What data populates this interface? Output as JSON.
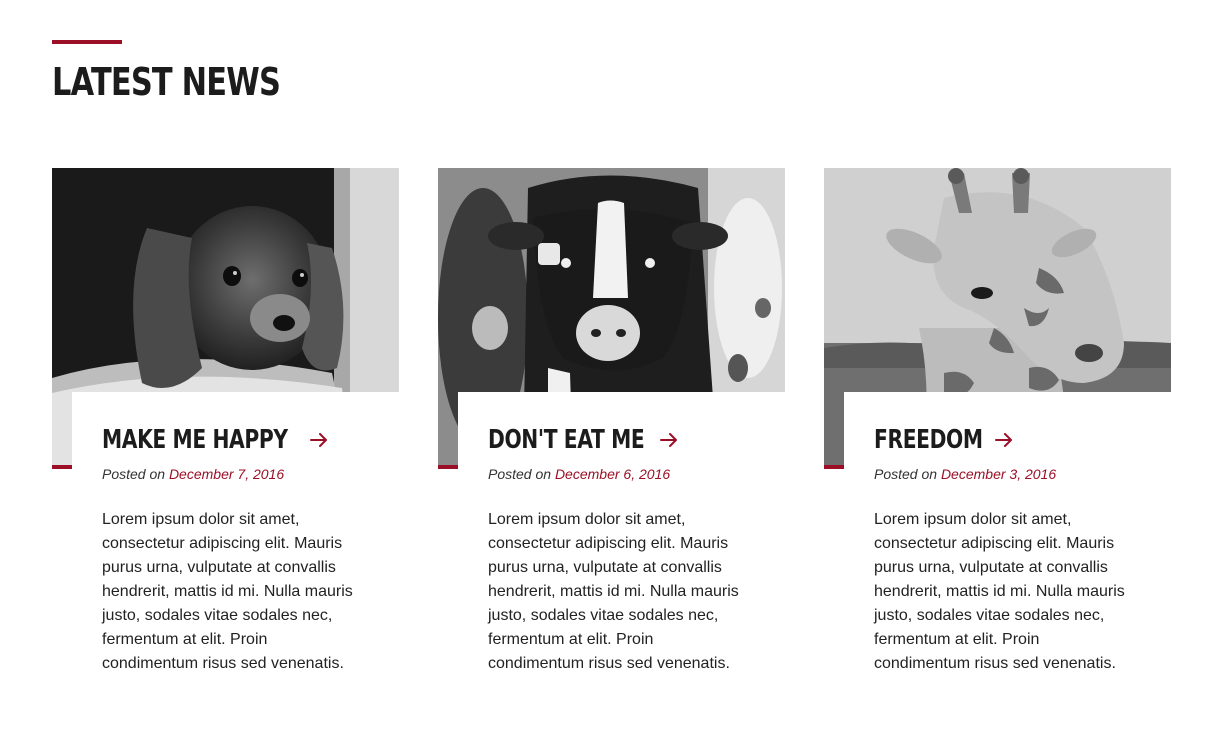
{
  "section": {
    "title": "LATEST NEWS"
  },
  "colors": {
    "accent": "#9b1026",
    "heading": "#1c1c1c",
    "body_text": "#222222"
  },
  "posts": [
    {
      "title": "MAKE ME HAPPY",
      "posted_on": "Posted on",
      "date": "December 7, 2016",
      "excerpt": "Lorem ipsum dolor sit amet, consectetur adipiscing elit. Mauris purus urna, vulputate at convallis hendrerit, mattis id mi. Nulla mauris justo, sodales vitae sodales nec, fermentum at elit. Proin condimentum risus sed venenatis.",
      "image": "dog-photo",
      "link_icon": "arrow-right-icon"
    },
    {
      "title": "DON'T EAT ME",
      "posted_on": "Posted on",
      "date": "December 6, 2016",
      "excerpt": "Lorem ipsum dolor sit amet, consectetur adipiscing elit. Mauris purus urna, vulputate at convallis hendrerit, mattis id mi. Nulla mauris justo, sodales vitae sodales nec, fermentum at elit. Proin condimentum risus sed venenatis.",
      "image": "cow-photo",
      "link_icon": "arrow-right-icon"
    },
    {
      "title": "FREEDOM",
      "posted_on": "Posted on",
      "date": "December 3, 2016",
      "excerpt": "Lorem ipsum dolor sit amet, consectetur adipiscing elit. Mauris purus urna, vulputate at convallis hendrerit, mattis id mi. Nulla mauris justo, sodales vitae sodales nec, fermentum at elit. Proin condimentum risus sed venenatis.",
      "image": "giraffe-photo",
      "link_icon": "arrow-right-icon"
    }
  ]
}
